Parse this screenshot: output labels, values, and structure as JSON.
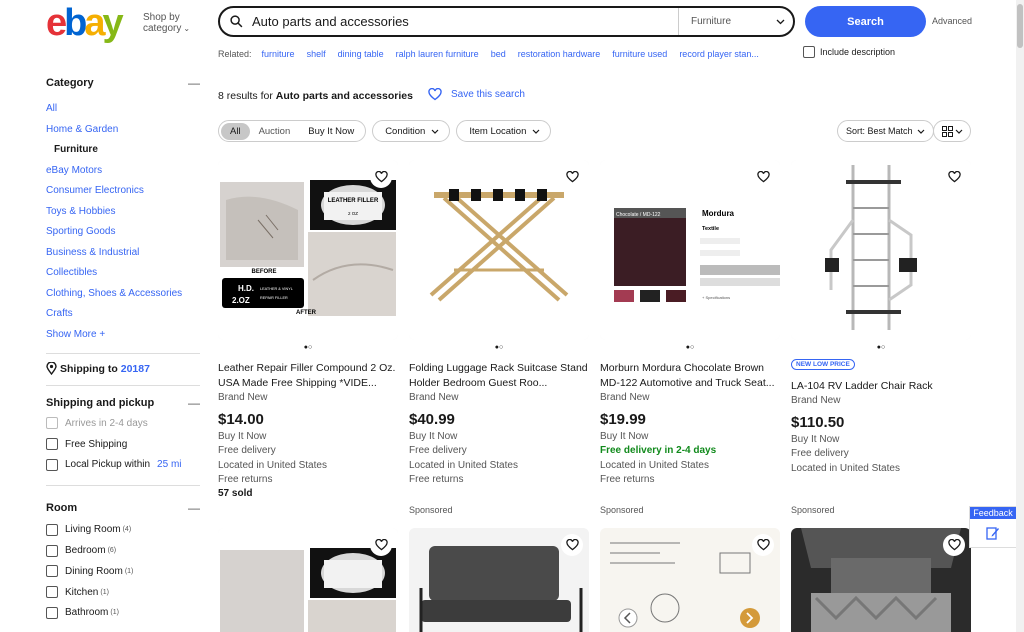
{
  "header": {
    "logo": "ebay",
    "shop_by": "Shop by",
    "category_word": "category",
    "search_value": "Auto parts and accessories",
    "search_category": "Furniture",
    "search_button": "Search",
    "advanced": "Advanced"
  },
  "related": {
    "label": "Related:",
    "links": [
      "furniture",
      "shelf",
      "dining table",
      "ralph lauren furniture",
      "bed",
      "restoration hardware",
      "furniture used",
      "record player stan..."
    ],
    "include_description": "Include description"
  },
  "sidebar": {
    "category_title": "Category",
    "categories": [
      "All",
      "Home & Garden",
      "Furniture",
      "eBay Motors",
      "Consumer Electronics",
      "Toys & Hobbies",
      "Sporting Goods",
      "Business & Industrial",
      "Collectibles",
      "Clothing, Shoes & Accessories",
      "Crafts",
      "Show More +"
    ],
    "shipping_to_label": "Shipping to",
    "zip": "20187",
    "shipping_pickup_title": "Shipping and pickup",
    "shipping_options": [
      "Arrives in 2-4 days",
      "Free Shipping",
      "Local Pickup within"
    ],
    "pickup_distance": "25 mi",
    "room_title": "Room",
    "rooms": [
      {
        "label": "Living Room",
        "count": "(4)"
      },
      {
        "label": "Bedroom",
        "count": "(6)"
      },
      {
        "label": "Dining Room",
        "count": "(1)"
      },
      {
        "label": "Kitchen",
        "count": "(1)"
      },
      {
        "label": "Bathroom",
        "count": "(1)"
      }
    ]
  },
  "results": {
    "count_prefix": "8 results for",
    "query": "Auto parts and accessories",
    "save_search": "Save this search"
  },
  "filters": {
    "tabs": [
      "All",
      "Auction",
      "Buy It Now"
    ],
    "condition": "Condition",
    "item_location": "Item Location",
    "sort": "Sort: Best Match"
  },
  "listings": [
    {
      "title": "Leather Repair Filler Compound 2 Oz. USA Made Free Shipping *VIDE...",
      "condition": "Brand New",
      "price": "$14.00",
      "buy_format": "Buy It Now",
      "delivery": "Free delivery",
      "location": "Located in United States",
      "returns": "Free returns",
      "sold": "57 sold",
      "image_texts": [
        "LEATHER FILLER",
        "2 OZ",
        "BEFORE",
        "H.D.",
        "2.OZ",
        "LEATHER & VINYL",
        "REPAIR FILLER",
        "AFTER"
      ]
    },
    {
      "title": "Folding Luggage Rack Suitcase Stand Holder Bedroom Guest Roo...",
      "condition": "Brand New",
      "price": "$40.99",
      "buy_format": "Buy It Now",
      "delivery": "Free delivery",
      "location": "Located in United States",
      "returns": "Free returns",
      "sponsored": "Sponsored"
    },
    {
      "title": "Morburn Mordura Chocolate Brown MD-122 Automotive and Truck Seat...",
      "condition": "Brand New",
      "price": "$19.99",
      "buy_format": "Buy It Now",
      "delivery": "Free delivery in 2-4 days",
      "location": "Located in United States",
      "returns": "Free returns",
      "sponsored": "Sponsored",
      "image_texts": [
        "Chocolate / MD-122",
        "Mordura",
        "Textile",
        "+ Specifications"
      ]
    },
    {
      "badge": "NEW LOW PRICE",
      "title": "LA-104 RV Ladder Chair Rack",
      "condition": "Brand New",
      "price": "$110.50",
      "buy_format": "Buy It Now",
      "delivery": "Free delivery",
      "location": "Located in United States",
      "sponsored": "Sponsored"
    }
  ],
  "feedback": "Feedback",
  "colors": {
    "accent": "#3665f3",
    "green": "#118a1c",
    "text": "#191919"
  }
}
